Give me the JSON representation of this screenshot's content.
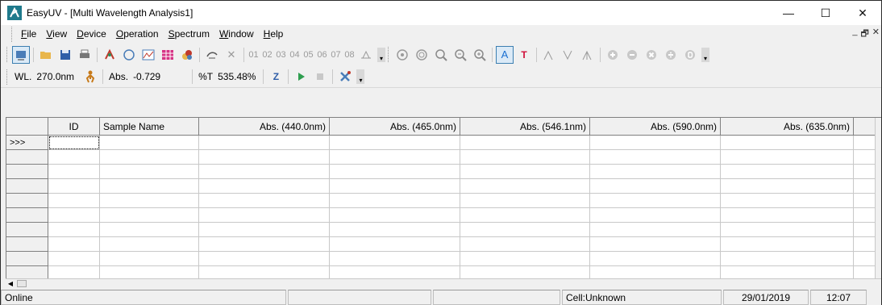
{
  "window": {
    "title": "EasyUV - [Multi Wavelength Analysis1]",
    "controls": {
      "minimize": "—",
      "maximize": "☐",
      "close": "✕"
    }
  },
  "menu": {
    "items": [
      {
        "label": "File",
        "underline": "F",
        "rest": "ile"
      },
      {
        "label": "View",
        "underline": "V",
        "rest": "iew"
      },
      {
        "label": "Device",
        "underline": "D",
        "rest": "evice"
      },
      {
        "label": "Operation",
        "underline": "O",
        "rest": "peration"
      },
      {
        "label": "Spectrum",
        "underline": "S",
        "rest": "pectrum"
      },
      {
        "label": "Window",
        "underline": "W",
        "rest": "indow"
      },
      {
        "label": "Help",
        "underline": "H",
        "rest": "elp"
      }
    ],
    "mdi_controls": {
      "minimize": "_",
      "restore": "🗗",
      "close": "✕"
    }
  },
  "toolbar1": {
    "cell_numbers": [
      "01",
      "02",
      "03",
      "04",
      "05",
      "06",
      "07",
      "08"
    ],
    "text_tool": "A",
    "title_tool": "T"
  },
  "readout": {
    "wl_label": "WL.",
    "wl_value": "270.0nm",
    "abs_label": "Abs.",
    "abs_value": "-0.729",
    "t_label": "%T",
    "t_value": "535.48%",
    "zero_label": "Z"
  },
  "table": {
    "columns": [
      "ID",
      "Sample Name",
      "Abs. (440.0nm)",
      "Abs. (465.0nm)",
      "Abs. (546.1nm)",
      "Abs. (590.0nm)",
      "Abs. (635.0nm)"
    ],
    "current_row_marker": ">>>",
    "rows": [
      [
        "",
        "",
        "",
        "",
        "",
        "",
        ""
      ],
      [
        "",
        "",
        "",
        "",
        "",
        "",
        ""
      ],
      [
        "",
        "",
        "",
        "",
        "",
        "",
        ""
      ],
      [
        "",
        "",
        "",
        "",
        "",
        "",
        ""
      ],
      [
        "",
        "",
        "",
        "",
        "",
        "",
        ""
      ],
      [
        "",
        "",
        "",
        "",
        "",
        "",
        ""
      ],
      [
        "",
        "",
        "",
        "",
        "",
        "",
        ""
      ],
      [
        "",
        "",
        "",
        "",
        "",
        "",
        ""
      ],
      [
        "",
        "",
        "",
        "",
        "",
        "",
        ""
      ],
      [
        "",
        "",
        "",
        "",
        "",
        "",
        ""
      ]
    ]
  },
  "status": {
    "connection": "Online",
    "panel2": "",
    "panel3": "",
    "cell": "Cell:Unknown",
    "date": "29/01/2019",
    "time": "12:07"
  },
  "colors": {
    "accent": "#3c7fb1",
    "logo": "#1f7a8c",
    "text_tool": "#1a6fd1",
    "title_tool": "#d0103a"
  }
}
